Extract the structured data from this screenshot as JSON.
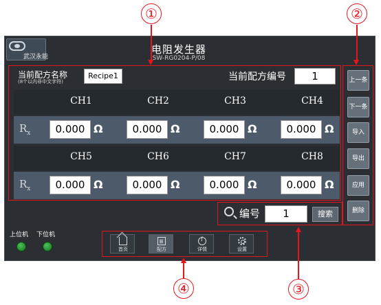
{
  "header": {
    "logo_text": "武汉永能",
    "title": "电阻发生器",
    "model": "SW-RG0204-P/08"
  },
  "recipe": {
    "name_label": "当前配方名称",
    "name_hint": "(8个以内非中文字符)",
    "name_value": "Recipe1",
    "number_label": "当前配方编号",
    "number_value": "1"
  },
  "table": {
    "row_label": "R",
    "row_label_sub": "x",
    "unit": "Ω",
    "groups": [
      {
        "channels": [
          "CH1",
          "CH2",
          "CH3",
          "CH4"
        ],
        "values": [
          "0.000",
          "0.000",
          "0.000",
          "0.000"
        ]
      },
      {
        "channels": [
          "CH5",
          "CH6",
          "CH7",
          "CH8"
        ],
        "values": [
          "0.000",
          "0.000",
          "0.000",
          "0.000"
        ]
      }
    ]
  },
  "search": {
    "icon": "search-icon",
    "label": "编号",
    "value": "1",
    "button_label": "搜索"
  },
  "side_buttons": [
    "上一条",
    "下一条",
    "导入",
    "导出",
    "应用",
    "删除"
  ],
  "indicators": {
    "upper_label": "上位机",
    "lower_label": "下位机",
    "led_color": "#3fb84a"
  },
  "nav": {
    "items": [
      {
        "label": "首页",
        "icon": "home-icon"
      },
      {
        "label": "配方",
        "icon": "recipe-icon"
      },
      {
        "label": "详情",
        "icon": "info-icon"
      },
      {
        "label": "设置",
        "icon": "gear-icon"
      }
    ],
    "active_index": 1
  },
  "callouts": [
    "①",
    "②",
    "③",
    "④"
  ],
  "colors": {
    "annotation_red": "#e8141b",
    "panel_bg": "#2b2f33",
    "value_row_bg": "#4c5a69",
    "header_row_bg": "#252a2f"
  }
}
